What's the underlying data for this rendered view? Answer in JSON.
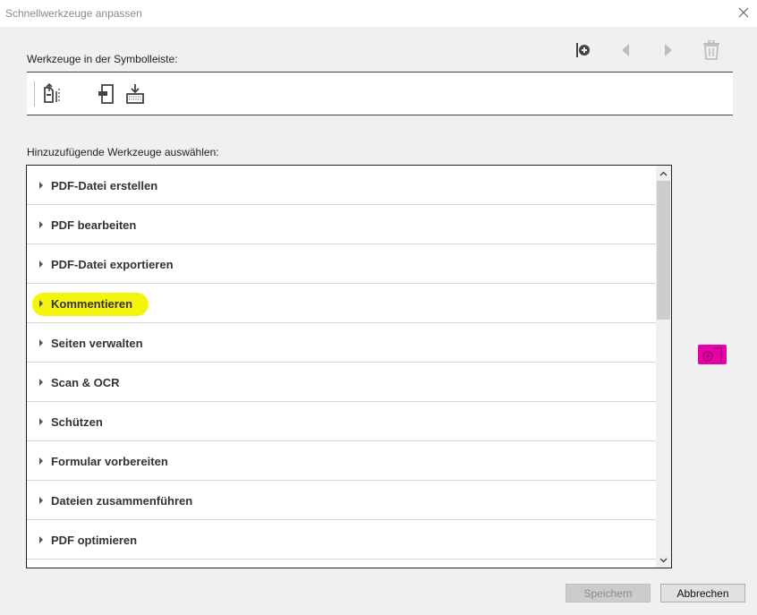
{
  "window": {
    "title": "Schnellwerkzeuge anpassen",
    "close_icon": "close-icon"
  },
  "toolbar_section": {
    "label": "Werkzeuge in der Symbolleiste:",
    "actions": [
      {
        "name": "add-separator-icon"
      },
      {
        "name": "move-left-icon"
      },
      {
        "name": "move-right-icon"
      },
      {
        "name": "delete-icon"
      }
    ],
    "tools": [
      {
        "name": "export-pdf-tool-icon"
      },
      {
        "name": "insert-page-tool-icon"
      },
      {
        "name": "scan-import-tool-icon"
      }
    ]
  },
  "select_section": {
    "label": "Hinzuzufügende Werkzeuge auswählen:",
    "items": [
      {
        "label": "PDF-Datei erstellen"
      },
      {
        "label": "PDF bearbeiten"
      },
      {
        "label": "PDF-Datei exportieren"
      },
      {
        "label": "Kommentieren"
      },
      {
        "label": "Seiten verwalten"
      },
      {
        "label": "Scan & OCR"
      },
      {
        "label": "Schützen"
      },
      {
        "label": "Formular vorbereiten"
      },
      {
        "label": "Dateien zusammenführen"
      },
      {
        "label": "PDF optimieren"
      }
    ],
    "highlighted_item": "Kommentieren",
    "highlight_color": "#f4f300"
  },
  "side_action": {
    "icon": "add-to-toolbar-icon",
    "color": "#e600a8"
  },
  "buttons": {
    "save": "Speichern",
    "cancel": "Abbrechen"
  }
}
